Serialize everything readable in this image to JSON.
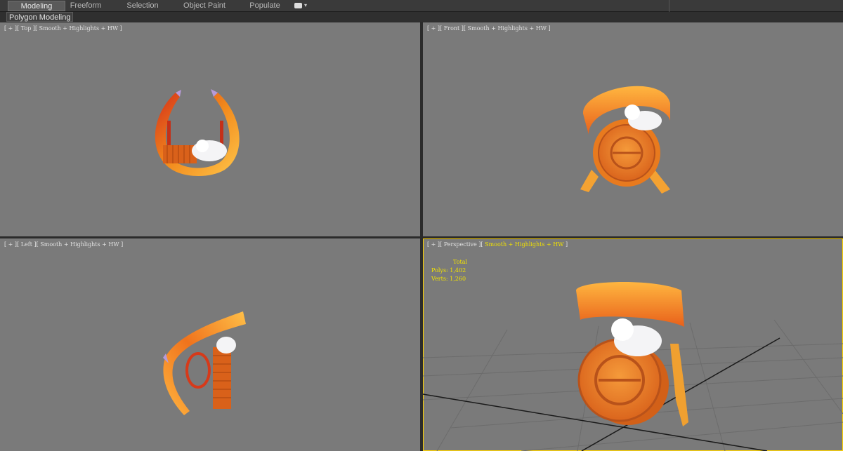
{
  "ribbon": {
    "tabs": [
      {
        "label": "Modeling",
        "active": true
      },
      {
        "label": "Freeform",
        "active": false
      },
      {
        "label": "Selection",
        "active": false
      },
      {
        "label": "Object Paint",
        "active": false
      },
      {
        "label": "Populate",
        "active": false
      }
    ],
    "options_icon": "ribbon-options-icon"
  },
  "subpanel": {
    "label": "Polygon Modeling"
  },
  "viewports": {
    "top": {
      "label": "[ + ][ Top ][ Smooth + Highlights + HW ]"
    },
    "front": {
      "label": "[ + ][ Front ][ Smooth + Highlights + HW ]"
    },
    "left": {
      "label": "[ + ][ Left ][ Smooth + Highlights + HW ]"
    },
    "perspective": {
      "label_prefix": "[ + ][ Perspective ][",
      "label_shading": " Smooth + Highlights + HW ",
      "label_suffix": "]",
      "stats": {
        "title": "Total",
        "polys": "Polys:  1,402",
        "verts": "Verts:  1,260"
      }
    }
  },
  "colors": {
    "viewport_bg": "#7a7a7a",
    "active_highlight": "#f2e200",
    "ribbon_orange": "#f07a18",
    "mooncake": "#e8781e",
    "bunny": "#f4f4f6"
  }
}
